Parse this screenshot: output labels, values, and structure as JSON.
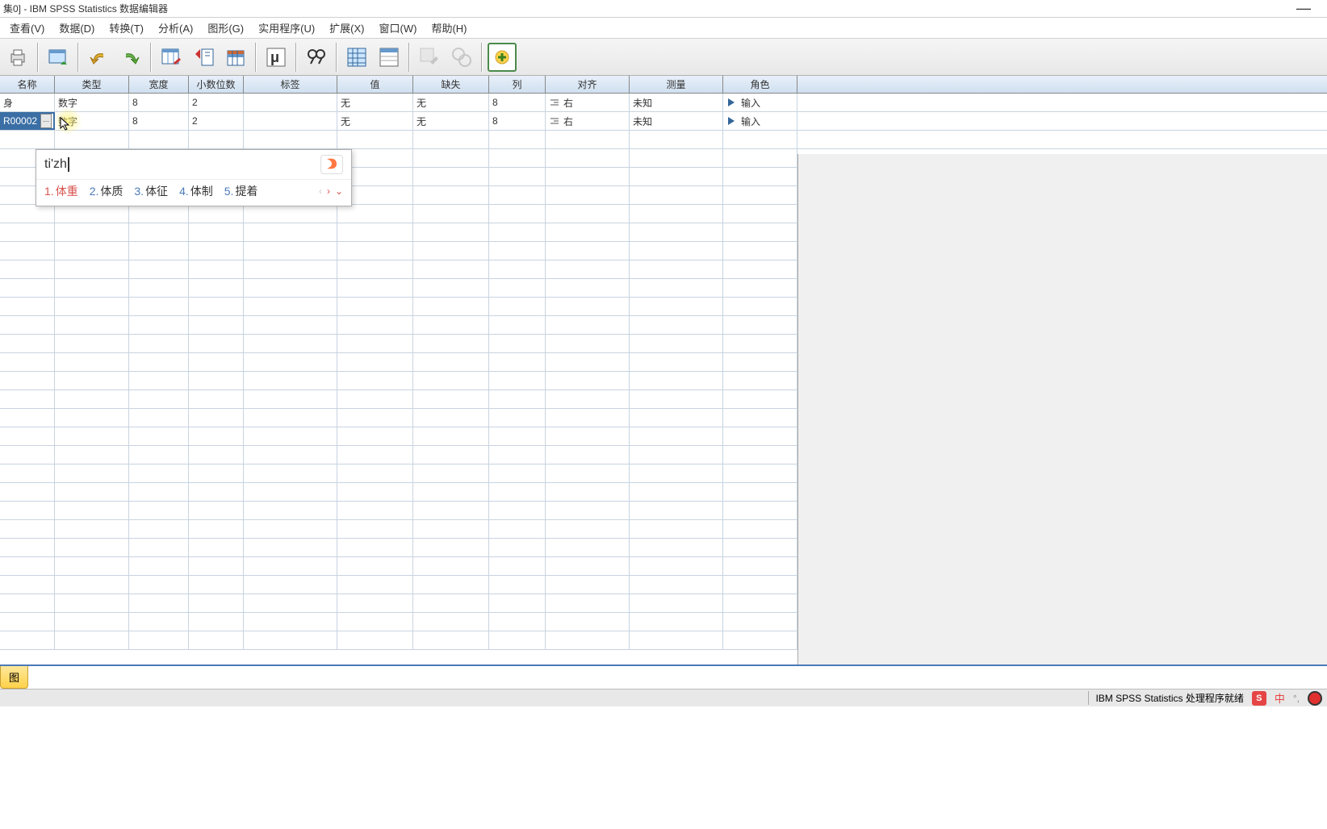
{
  "title": "集0] - IBM SPSS Statistics 数据编辑器",
  "menu": {
    "view": "查看(V)",
    "data": "数据(D)",
    "transform": "转换(T)",
    "analyze": "分析(A)",
    "graphs": "图形(G)",
    "utilities": "实用程序(U)",
    "extend": "扩展(X)",
    "window": "窗口(W)",
    "help": "帮助(H)"
  },
  "columns": {
    "name": "名称",
    "type": "类型",
    "width": "宽度",
    "decimals": "小数位数",
    "label": "标签",
    "values": "值",
    "missing": "缺失",
    "columns_w": "列",
    "align": "对齐",
    "measure": "测量",
    "role": "角色"
  },
  "rows": [
    {
      "name": "身",
      "type": "数字",
      "width": "8",
      "decimals": "2",
      "label": "",
      "values": "无",
      "missing": "无",
      "columns_w": "8",
      "align": "右",
      "measure": "未知",
      "role": "输入"
    },
    {
      "name": "R00002",
      "type": "数字",
      "width": "8",
      "decimals": "2",
      "label": "",
      "values": "无",
      "missing": "无",
      "columns_w": "8",
      "align": "右",
      "measure": "未知",
      "role": "输入"
    }
  ],
  "editing_cell_value": "R00002",
  "ime": {
    "input": "ti'zh",
    "candidates": [
      "体重",
      "体质",
      "体征",
      "体制",
      "提着"
    ]
  },
  "bottom_tab": "图",
  "status": {
    "ready_text": "IBM SPSS Statistics 处理程序就绪",
    "lang": "中"
  }
}
